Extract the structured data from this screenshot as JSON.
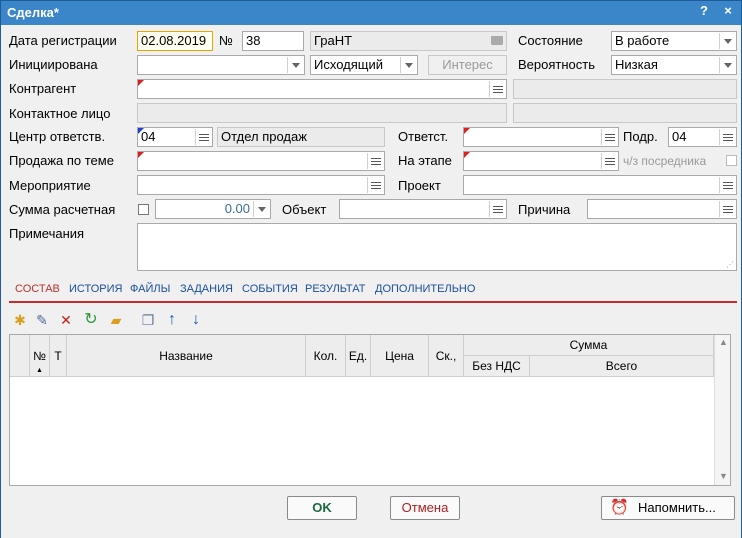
{
  "window": {
    "title": "Сделка*",
    "help": "?",
    "close": "×"
  },
  "form": {
    "reg_date_label": "Дата регистрации",
    "reg_date_value": "02.08.2019",
    "number_label": "№",
    "number_value": "38",
    "org_value": "ГраНТ",
    "state_label": "Состояние",
    "state_value": "В работе",
    "initiated_label": "Инициирована",
    "initiated_value": "",
    "direction_value": "Исходящий",
    "interest_button": "Интерес",
    "probability_label": "Вероятность",
    "probability_value": "Низкая",
    "counterparty_label": "Контрагент",
    "contact_label": "Контактное лицо",
    "resp_center_label": "Центр ответств.",
    "resp_center_code": "04",
    "resp_center_name": "Отдел продаж",
    "responsible_label": "Ответст.",
    "division_label": "Подр.",
    "division_value": "04",
    "sale_topic_label": "Продажа по теме",
    "stage_label": "На этапе",
    "intermediary_label": "ч/з посредника",
    "event_label": "Мероприятие",
    "project_label": "Проект",
    "sum_label": "Сумма расчетная",
    "sum_value": "0.00",
    "object_label": "Объект",
    "reason_label": "Причина",
    "notes_label": "Примечания"
  },
  "tabs": [
    {
      "label": "СОСТАВ",
      "active": true
    },
    {
      "label": "ИСТОРИЯ"
    },
    {
      "label": "ФАЙЛЫ"
    },
    {
      "label": "ЗАДАНИЯ"
    },
    {
      "label": "СОБЫТИЯ"
    },
    {
      "label": "РЕЗУЛЬТАТ"
    },
    {
      "label": "ДОПОЛНИТЕЛЬНО"
    }
  ],
  "grid": {
    "col_no": "№",
    "col_t": "Т",
    "col_name": "Название",
    "col_qty": "Кол.",
    "col_unit": "Ед.",
    "col_price": "Цена",
    "col_disc": "Ск.,",
    "col_sum": "Сумма",
    "col_sum_novat": "Без НДС",
    "col_sum_total": "Всего"
  },
  "buttons": {
    "ok": "OK",
    "cancel": "Отмена",
    "remind": "Напомнить..."
  },
  "colors": {
    "titlebar": "#3a86c8",
    "tab_active": "#c03030",
    "tab": "#1a4fa0",
    "ok_text": "#1a6a3a",
    "cancel_text": "#b02020"
  }
}
